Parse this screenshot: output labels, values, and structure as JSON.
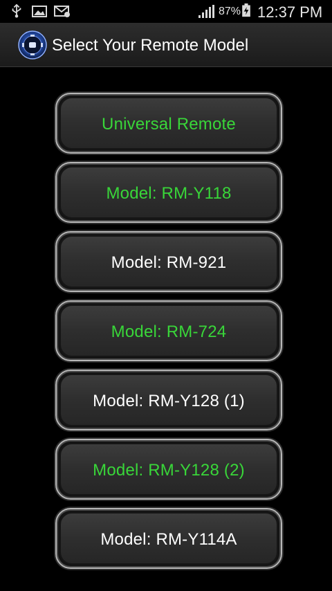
{
  "status_bar": {
    "battery_percent": "87%",
    "time": "12:37 PM",
    "icons": [
      "usb-icon",
      "image-icon",
      "email-icon",
      "signal-icon",
      "charging-battery-icon"
    ]
  },
  "action_bar": {
    "title": "Select Your Remote Model",
    "icon": "remote-app-icon"
  },
  "colors": {
    "green": "#39d639",
    "white": "#ffffff"
  },
  "models": [
    {
      "label": "Universal Remote",
      "color": "#39d639"
    },
    {
      "label": "Model: RM-Y118",
      "color": "#39d639"
    },
    {
      "label": "Model: RM-921",
      "color": "#ffffff"
    },
    {
      "label": "Model: RM-724",
      "color": "#39d639"
    },
    {
      "label": "Model: RM-Y128 (1)",
      "color": "#ffffff"
    },
    {
      "label": "Model: RM-Y128 (2)",
      "color": "#39d639"
    },
    {
      "label": "Model: RM-Y114A",
      "color": "#ffffff"
    }
  ]
}
